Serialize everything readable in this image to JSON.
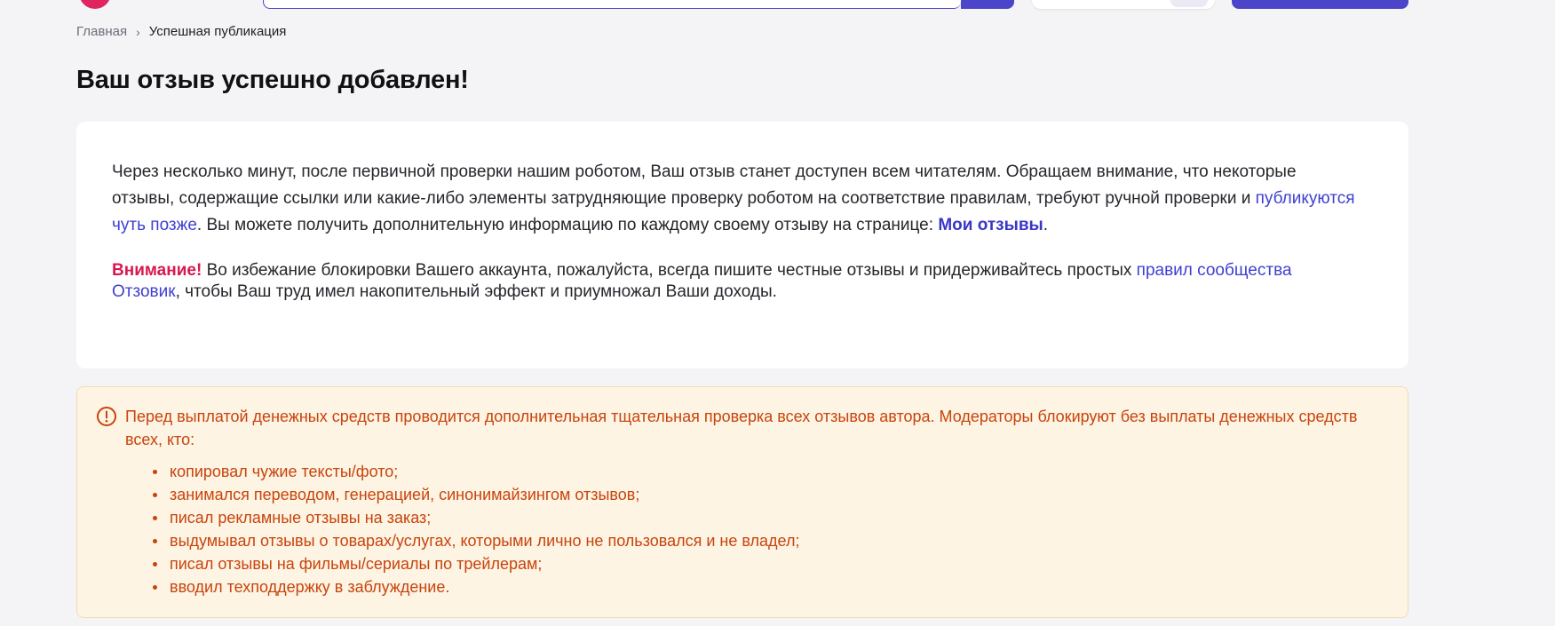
{
  "breadcrumb": {
    "home": "Главная",
    "separator": "›",
    "current": "Успешная публикация"
  },
  "page_title": "Ваш отзыв успешно добавлен!",
  "info": {
    "p1_start": "Через несколько минут, после первичной проверки нашим роботом, Ваш отзыв станет доступен всем читателям. Обращаем внимание, что некоторые отзывы, содержащие ссылки или какие-либо элементы затрудняющие проверку роботом на соответствие правилам, требуют ручной проверки и ",
    "p1_link": "публикуются чуть позже",
    "p1_middle": ". Вы можете получить дополнительную информацию по каждому своему отзыву на странице: ",
    "p1_link2": "Мои отзывы",
    "p1_end": ".",
    "warning_label": "Внимание!",
    "p2_start": " Во избежание блокировки Вашего аккаунта, пожалуйста, всегда пишите честные отзывы и придерживайтесь простых ",
    "p2_link": "правил сообщества Отзовик",
    "p2_end": ", чтобы Ваш труд имел накопительный эффект и приумножал Ваши доходы."
  },
  "notice": {
    "icon": "exclamation-circle-icon",
    "lead": "Перед выплатой денежных средств проводится дополнительная тщательная проверка всех отзывов автора. Модераторы блокируют без выплаты денежных средств всех, кто:",
    "items": [
      "копировал чужие тексты/фото;",
      "занимался переводом, генерацией, синонимайзингом отзывов;",
      "писал рекламные отзывы на заказ;",
      "выдумывал отзывы о товарах/услугах, которыми лично не пользовался и не владел;",
      "писал отзывы на фильмы/сериалы по трейлерам;",
      "вводил техподдержку в заблуждение."
    ]
  },
  "colors": {
    "brand_accent": "#4a45c9",
    "link": "#3f3fd1",
    "warning_red": "#d8184f",
    "notice_text": "#c8440c",
    "notice_bg": "#fdf4e4",
    "page_bg": "#f4f4f7"
  }
}
